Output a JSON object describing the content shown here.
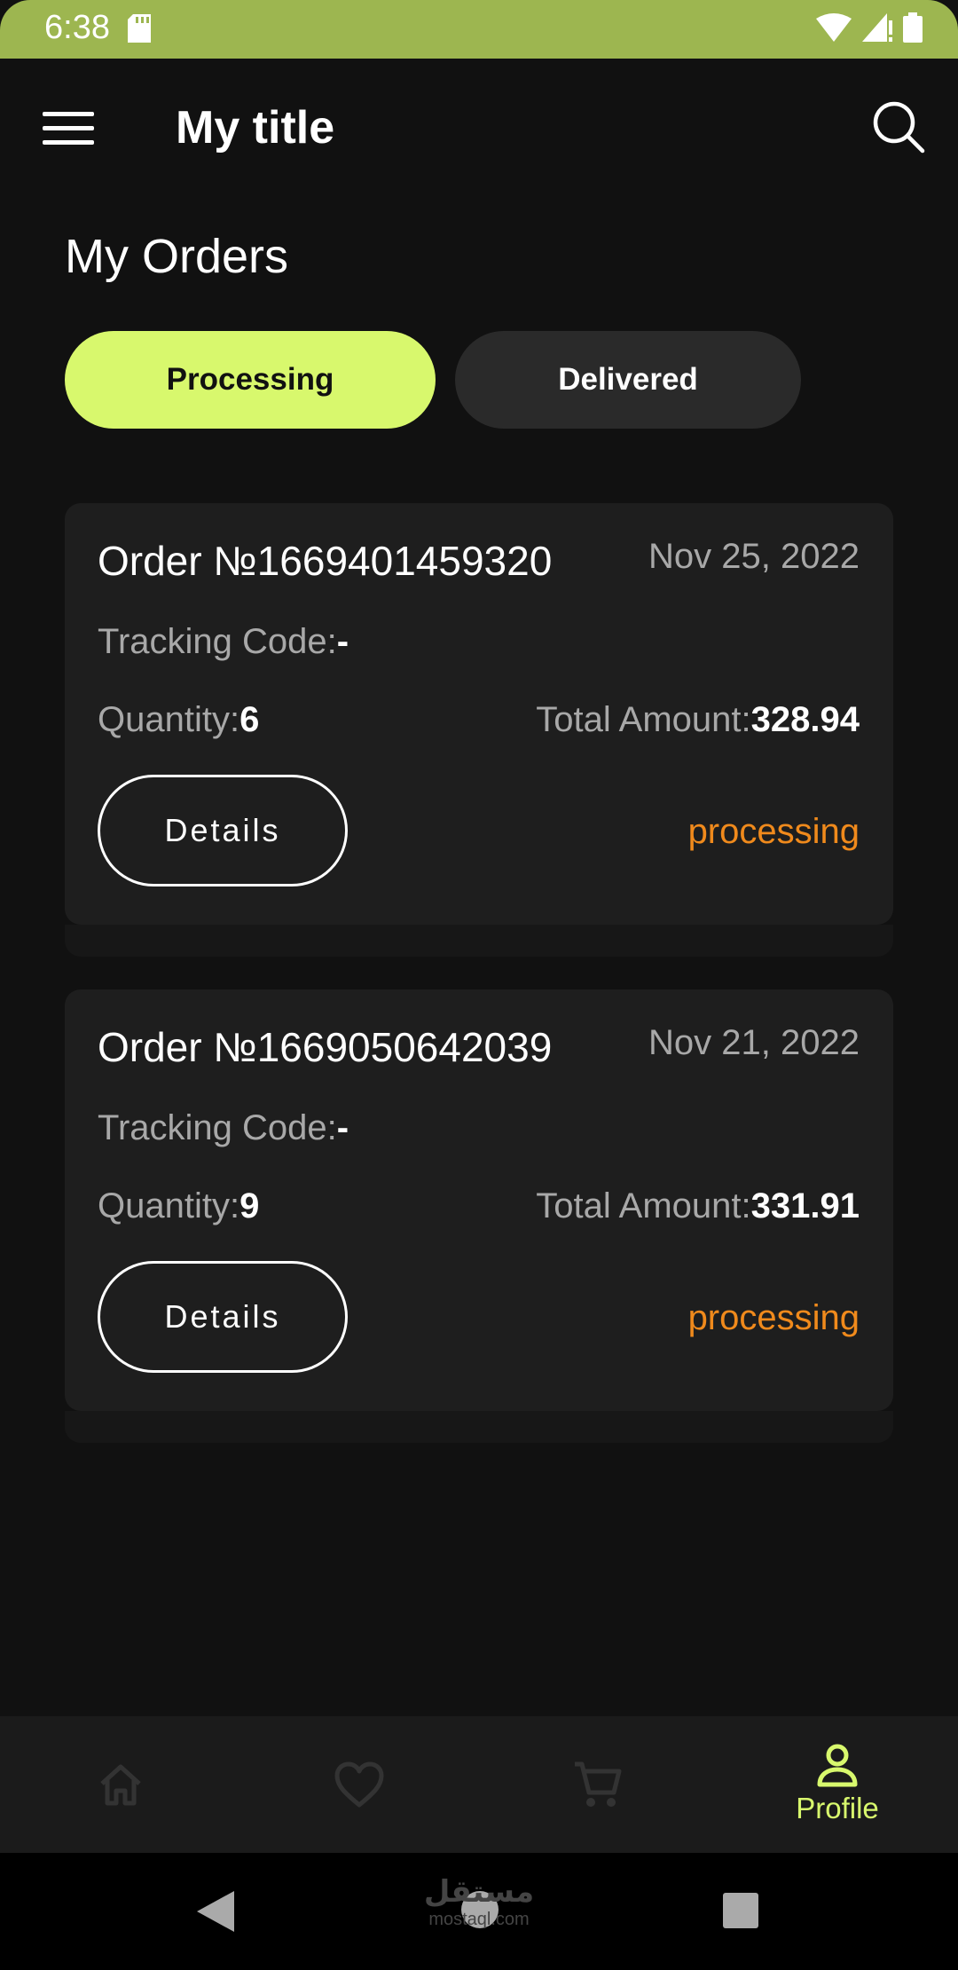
{
  "status_bar": {
    "time": "6:38"
  },
  "app_bar": {
    "title": "My title"
  },
  "page": {
    "title": "My Orders"
  },
  "tabs": [
    {
      "label": "Processing",
      "active": true
    },
    {
      "label": "Delivered",
      "active": false
    }
  ],
  "orders": [
    {
      "number": "Order №1669401459320",
      "date": "Nov 25, 2022",
      "tracking_label": "Tracking Code:",
      "tracking_value": "-",
      "quantity_label": "Quantity:",
      "quantity_value": "6",
      "total_label": "Total Amount:",
      "total_value": "328.94",
      "details_label": "Details",
      "status": "processing"
    },
    {
      "number": "Order №1669050642039",
      "date": "Nov 21, 2022",
      "tracking_label": "Tracking Code:",
      "tracking_value": "-",
      "quantity_label": "Quantity:",
      "quantity_value": "9",
      "total_label": "Total Amount:",
      "total_value": "331.91",
      "details_label": "Details",
      "status": "processing"
    }
  ],
  "bottom_nav": {
    "items": [
      {
        "icon": "home-icon"
      },
      {
        "icon": "heart-icon"
      },
      {
        "icon": "cart-icon"
      },
      {
        "icon": "person-icon",
        "label": "Profile",
        "active": true
      }
    ]
  },
  "watermark": {
    "arabic": "مستقل",
    "latin": "mostaql.com"
  },
  "colors": {
    "accent": "#d8f86d",
    "status_bar": "#9db650",
    "status_processing": "#f08a1c",
    "background": "#111111",
    "card": "#1e1e1e"
  }
}
